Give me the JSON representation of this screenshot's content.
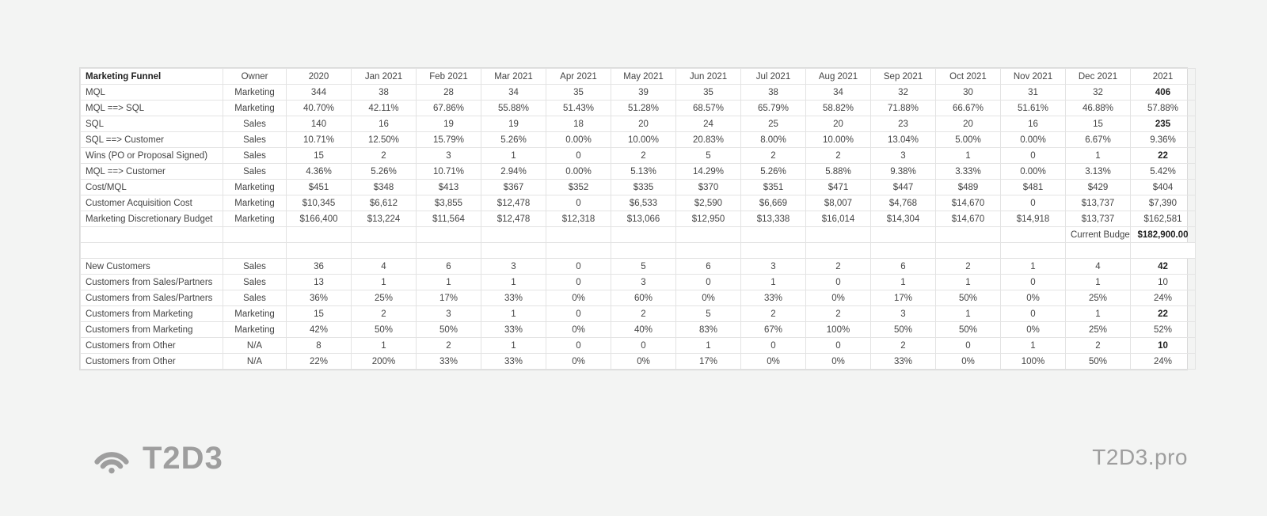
{
  "brand": {
    "logo_text": "T2D3",
    "url": "T2D3.pro"
  },
  "table": {
    "title": "Marketing Funnel",
    "columns": [
      "Owner",
      "2020",
      "Jan 2021",
      "Feb 2021",
      "Mar 2021",
      "Apr 2021",
      "May 2021",
      "Jun 2021",
      "Jul 2021",
      "Aug 2021",
      "Sep 2021",
      "Oct 2021",
      "Nov 2021",
      "Dec 2021",
      "2021"
    ],
    "rows": [
      {
        "label": "MQL",
        "cells": [
          "Marketing",
          "344",
          "38",
          "28",
          "34",
          "35",
          "39",
          "35",
          "38",
          "34",
          "32",
          "30",
          "31",
          "32",
          "406"
        ],
        "bold_last": true
      },
      {
        "label": "MQL ==> SQL",
        "cells": [
          "Marketing",
          "40.70%",
          "42.11%",
          "67.86%",
          "55.88%",
          "51.43%",
          "51.28%",
          "68.57%",
          "65.79%",
          "58.82%",
          "71.88%",
          "66.67%",
          "51.61%",
          "46.88%",
          "57.88%"
        ]
      },
      {
        "label": "SQL",
        "cells": [
          "Sales",
          "140",
          "16",
          "19",
          "19",
          "18",
          "20",
          "24",
          "25",
          "20",
          "23",
          "20",
          "16",
          "15",
          "235"
        ],
        "bold_last": true
      },
      {
        "label": "SQL ==> Customer",
        "cells": [
          "Sales",
          "10.71%",
          "12.50%",
          "15.79%",
          "5.26%",
          "0.00%",
          "10.00%",
          "20.83%",
          "8.00%",
          "10.00%",
          "13.04%",
          "5.00%",
          "0.00%",
          "6.67%",
          "9.36%"
        ]
      },
      {
        "label": "Wins (PO or Proposal Signed)",
        "cells": [
          "Sales",
          "15",
          "2",
          "3",
          "1",
          "0",
          "2",
          "5",
          "2",
          "2",
          "3",
          "1",
          "0",
          "1",
          "22"
        ],
        "bold_last": true
      },
      {
        "label": "MQL ==> Customer",
        "cells": [
          "Sales",
          "4.36%",
          "5.26%",
          "10.71%",
          "2.94%",
          "0.00%",
          "5.13%",
          "14.29%",
          "5.26%",
          "5.88%",
          "9.38%",
          "3.33%",
          "0.00%",
          "3.13%",
          "5.42%"
        ]
      },
      {
        "label": "Cost/MQL",
        "cells": [
          "Marketing",
          "$451",
          "$348",
          "$413",
          "$367",
          "$352",
          "$335",
          "$370",
          "$351",
          "$471",
          "$447",
          "$489",
          "$481",
          "$429",
          "$404"
        ]
      },
      {
        "label": "Customer Acquisition Cost",
        "cells": [
          "Marketing",
          "$10,345",
          "$6,612",
          "$3,855",
          "$12,478",
          "0",
          "$6,533",
          "$2,590",
          "$6,669",
          "$8,007",
          "$4,768",
          "$14,670",
          "0",
          "$13,737",
          "$7,390"
        ]
      },
      {
        "label": "Marketing Discretionary Budget",
        "cells": [
          "Marketing",
          "$166,400",
          "$13,224",
          "$11,564",
          "$12,478",
          "$12,318",
          "$13,066",
          "$12,950",
          "$13,338",
          "$16,014",
          "$14,304",
          "$14,670",
          "$14,918",
          "$13,737",
          "$162,581"
        ]
      }
    ],
    "budget_row": {
      "label": "Current Budget:",
      "value": "$182,900.00"
    },
    "rows2": [
      {
        "label": "New Customers",
        "cells": [
          "Sales",
          "36",
          "4",
          "6",
          "3",
          "0",
          "5",
          "6",
          "3",
          "2",
          "6",
          "2",
          "1",
          "4",
          "42"
        ],
        "bold_last": true
      },
      {
        "label": "Customers from Sales/Partners",
        "cells": [
          "Sales",
          "13",
          "1",
          "1",
          "1",
          "0",
          "3",
          "0",
          "1",
          "0",
          "1",
          "1",
          "0",
          "1",
          "10"
        ]
      },
      {
        "label": "Customers from Sales/Partners",
        "cells": [
          "Sales",
          "36%",
          "25%",
          "17%",
          "33%",
          "0%",
          "60%",
          "0%",
          "33%",
          "0%",
          "17%",
          "50%",
          "0%",
          "25%",
          "24%"
        ]
      },
      {
        "label": "Customers from Marketing",
        "cells": [
          "Marketing",
          "15",
          "2",
          "3",
          "1",
          "0",
          "2",
          "5",
          "2",
          "2",
          "3",
          "1",
          "0",
          "1",
          "22"
        ],
        "bold_last": true
      },
      {
        "label": "Customers from Marketing",
        "cells": [
          "Marketing",
          "42%",
          "50%",
          "50%",
          "33%",
          "0%",
          "40%",
          "83%",
          "67%",
          "100%",
          "50%",
          "50%",
          "0%",
          "25%",
          "52%"
        ]
      },
      {
        "label": "Customers from Other",
        "cells": [
          "N/A",
          "8",
          "1",
          "2",
          "1",
          "0",
          "0",
          "1",
          "0",
          "0",
          "2",
          "0",
          "1",
          "2",
          "10"
        ],
        "bold_last": true
      },
      {
        "label": "Customers from Other",
        "cells": [
          "N/A",
          "22%",
          "200%",
          "33%",
          "33%",
          "0%",
          "0%",
          "17%",
          "0%",
          "0%",
          "33%",
          "0%",
          "100%",
          "50%",
          "24%"
        ]
      }
    ]
  }
}
